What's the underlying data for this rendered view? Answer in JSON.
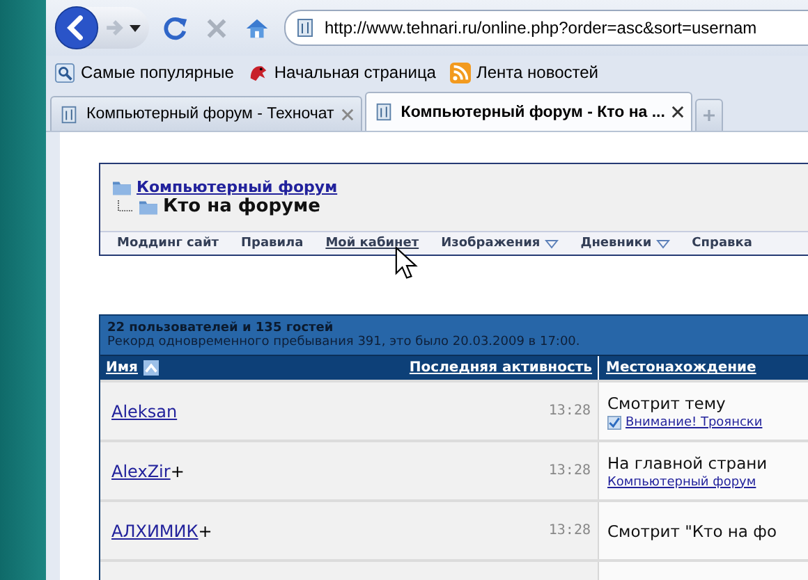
{
  "browser": {
    "address": "http://www.tehnari.ru/online.php?order=asc&sort=usernam",
    "favorites": [
      {
        "kind": "search",
        "label": "Самые популярные"
      },
      {
        "kind": "logo",
        "label": "Начальная страница"
      },
      {
        "kind": "feed",
        "label": "Лента новостей"
      }
    ],
    "tabs": [
      {
        "label": "Компьютерный форум - Техночат",
        "selected": false
      },
      {
        "label": "Компьютерный форум - Кто на ...",
        "selected": true
      }
    ]
  },
  "page": {
    "breadcrumb": {
      "parent": "Компьютерный форум",
      "current": "Кто на форуме"
    },
    "nav": [
      {
        "label": "Моддинг сайт",
        "dropdown": false,
        "hovered": false
      },
      {
        "label": "Правила",
        "dropdown": false,
        "hovered": false
      },
      {
        "label": "Мой кабинет",
        "dropdown": false,
        "hovered": true
      },
      {
        "label": "Изображения",
        "dropdown": true,
        "hovered": false
      },
      {
        "label": "Дневники",
        "dropdown": true,
        "hovered": false
      },
      {
        "label": "Справка",
        "dropdown": false,
        "hovered": false
      }
    ],
    "online": {
      "summary": "22 пользователей и 135 гостей",
      "record": "Рекорд одновременного пребывания 391, это было 20.03.2009 в 17:00.",
      "columns": [
        "Имя",
        "Последняя активность",
        "Местонахождение"
      ],
      "rows": [
        {
          "name": "Aleksan",
          "suffix": "",
          "time": "13:28",
          "location": "Смотрит тему",
          "link": "Внимание! Троянски",
          "link_icon": true
        },
        {
          "name": "AlexZir",
          "suffix": "+",
          "time": "13:28",
          "location": "На главной страни",
          "link": "Компьютерный форум",
          "link_icon": false
        },
        {
          "name": "АЛХИМИК",
          "suffix": "+",
          "time": "13:28",
          "location": "Смотрит \"Кто на фо",
          "link": "",
          "link_icon": false
        }
      ]
    }
  }
}
